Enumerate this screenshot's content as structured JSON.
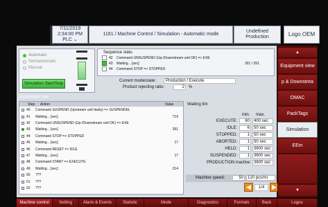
{
  "header": {
    "date": "7/11/2019",
    "time": "2:34:00 PM",
    "plc": "PLC",
    "breadcrumb": "1161 / Machine Control / Simulation - Automatic mode",
    "state_line1": "Undefined",
    "state_line2": "Production",
    "logo": "Logo OEM"
  },
  "modes": {
    "automatic": "Automatic",
    "semiautomatic": "Semiautomatic",
    "manual": "Manual",
    "sim_button": "Simulation Start/Stop"
  },
  "sequence": {
    "title": "Sequence statu",
    "lines": [
      {
        "step": "42",
        "text": "Command UNSUSPEND (Up-/Downstream unit OK) => EXE"
      },
      {
        "step": "43",
        "text": "Waiting... [sec]"
      },
      {
        "step": "44",
        "text": "Command STOP => STOPPED"
      }
    ],
    "counter": "301 / 391",
    "current_mode_label": "Current mode/state:",
    "current_mode_value": "Production / Execute",
    "reject_label": "Product rejecting ratio:",
    "reject_value": "2",
    "reject_unit": "%"
  },
  "auto": {
    "title": "Automatic mc",
    "col_step": "Step",
    "col_action": "Action",
    "col_value": "Value",
    "rows": [
      {
        "step": "40",
        "action": "Command SUSPEND (Upstream unit faulty) => SUSPENDEL",
        "value": ""
      },
      {
        "step": "41",
        "action": "Waiting... [sec]",
        "value": "719"
      },
      {
        "step": "42",
        "action": "Command UNSUSPEND (Up-/Downstream unit OK) => EXE",
        "value": ""
      },
      {
        "step": "43",
        "action": "Waiting... [sec]",
        "value": "391"
      },
      {
        "step": "44",
        "action": "Command STOP => STOPPED",
        "value": ""
      },
      {
        "step": "45",
        "action": "Waiting... [sec]",
        "value": "17"
      },
      {
        "step": "46",
        "action": "Command RESET => IDLE",
        "value": ""
      },
      {
        "step": "47",
        "action": "Waiting... [sec]",
        "value": "17"
      },
      {
        "step": "48",
        "action": "Command START => EXECUTE",
        "value": ""
      },
      {
        "step": "49",
        "action": "Waiting... [sec]",
        "value": "214"
      },
      {
        "step": "50",
        "action": "???",
        "value": ""
      },
      {
        "step": "51",
        "action": "???",
        "value": ""
      },
      {
        "step": "52",
        "action": "???",
        "value": ""
      }
    ]
  },
  "waiting": {
    "title": "Waiting tim",
    "col_min": "min.",
    "col_max": "max.",
    "rows": [
      {
        "label": "EXECUTE:",
        "min": "60",
        "max": "400 sec"
      },
      {
        "label": "IDLE:",
        "min": "6",
        "max": "50 sec"
      },
      {
        "label": "STOPPED:",
        "min": "1",
        "max": "50 sec"
      },
      {
        "label": "ABORTED:",
        "min": "1",
        "max": "50 sec"
      },
      {
        "label": "HELD:",
        "min": "1",
        "max": "3600 sec"
      },
      {
        "label": "SUSPENDED:",
        "min": "1",
        "max": "3600 sec"
      },
      {
        "label": "PRODUCTION inactive:",
        "min": "",
        "max": "3600 sec"
      }
    ],
    "speed_label": "Machine speed:",
    "speed_min": "50",
    "speed_max": "120 pcs/mi",
    "page": "1/4"
  },
  "sidebar": {
    "items": [
      "Equipment view",
      "p & Downstrea",
      "OMAC",
      "PackTags",
      "Simulation",
      "EEm"
    ]
  },
  "bottom": {
    "items": [
      "Machine control",
      "Setting",
      "Alarm & Events",
      "Statistic",
      "Mode",
      "Diagnostics",
      "Formats",
      "Back",
      "Logou"
    ]
  },
  "colors": {
    "accent": "#8a1414",
    "active_green": "#3ec13e",
    "orange_nav": "#f08a1c"
  }
}
